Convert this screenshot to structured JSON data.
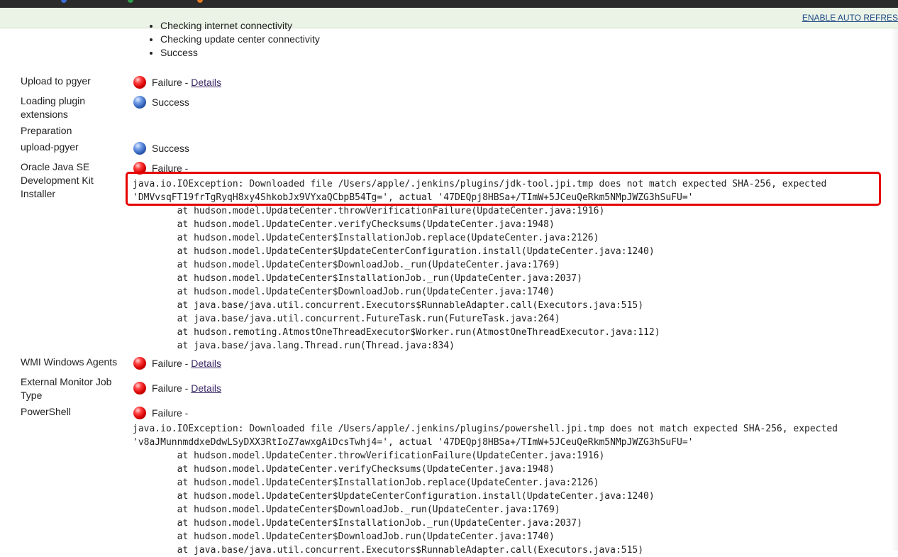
{
  "notice": {
    "enable_auto_refresh": "ENABLE AUTO REFRES"
  },
  "connectivity_steps": [
    "Checking internet connectivity",
    "Checking update center connectivity",
    "Success"
  ],
  "colors": {
    "failure": "#d40000",
    "success": "#2c5bb3",
    "highlight": "#e60000",
    "link": "#3b2a66"
  },
  "rows": {
    "pgyer": {
      "label": "Upload to pgyer",
      "status": "Failure -",
      "link": "Details"
    },
    "loading": {
      "label": "Loading plugin extensions",
      "status": "Success"
    },
    "preparation": {
      "label": "Preparation"
    },
    "upload_pgyer": {
      "label": "upload-pgyer",
      "status": "Success"
    },
    "oracle": {
      "label": "Oracle Java SE Development Kit Installer",
      "status": "Failure -",
      "exception": "java.io.IOException: Downloaded file /Users/apple/.jenkins/plugins/jdk-tool.jpi.tmp does not match expected SHA-256, expected\n'DMVvsqFT19frTgRyqH8xy4ShkobJx9VYxaQCbpB54Tg=', actual '47DEQpj8HBSa+/TImW+5JCeuQeRkm5NMpJWZG3hSuFU='",
      "stack": "        at hudson.model.UpdateCenter.throwVerificationFailure(UpdateCenter.java:1916)\n        at hudson.model.UpdateCenter.verifyChecksums(UpdateCenter.java:1948)\n        at hudson.model.UpdateCenter$InstallationJob.replace(UpdateCenter.java:2126)\n        at hudson.model.UpdateCenter$UpdateCenterConfiguration.install(UpdateCenter.java:1240)\n        at hudson.model.UpdateCenter$DownloadJob._run(UpdateCenter.java:1769)\n        at hudson.model.UpdateCenter$InstallationJob._run(UpdateCenter.java:2037)\n        at hudson.model.UpdateCenter$DownloadJob.run(UpdateCenter.java:1740)\n        at java.base/java.util.concurrent.Executors$RunnableAdapter.call(Executors.java:515)\n        at java.base/java.util.concurrent.FutureTask.run(FutureTask.java:264)\n        at hudson.remoting.AtmostOneThreadExecutor$Worker.run(AtmostOneThreadExecutor.java:112)\n        at java.base/java.lang.Thread.run(Thread.java:834)"
    },
    "wmi": {
      "label": "WMI Windows Agents",
      "status": "Failure -",
      "link": "Details"
    },
    "external": {
      "label": "External Monitor Job Type",
      "status": "Failure -",
      "link": "Details"
    },
    "powershell": {
      "label": "PowerShell",
      "status": "Failure -",
      "trace": "java.io.IOException: Downloaded file /Users/apple/.jenkins/plugins/powershell.jpi.tmp does not match expected SHA-256, expected\n'v8aJMunnmddxeDdwLSyDXX3RtIoZ7awxgAiDcsTwhj4=', actual '47DEQpj8HBSa+/TImW+5JCeuQeRkm5NMpJWZG3hSuFU='\n        at hudson.model.UpdateCenter.throwVerificationFailure(UpdateCenter.java:1916)\n        at hudson.model.UpdateCenter.verifyChecksums(UpdateCenter.java:1948)\n        at hudson.model.UpdateCenter$InstallationJob.replace(UpdateCenter.java:2126)\n        at hudson.model.UpdateCenter$UpdateCenterConfiguration.install(UpdateCenter.java:1240)\n        at hudson.model.UpdateCenter$DownloadJob._run(UpdateCenter.java:1769)\n        at hudson.model.UpdateCenter$InstallationJob._run(UpdateCenter.java:2037)\n        at hudson.model.UpdateCenter$DownloadJob.run(UpdateCenter.java:1740)\n        at java.base/java.util.concurrent.Executors$RunnableAdapter.call(Executors.java:515)"
    }
  }
}
